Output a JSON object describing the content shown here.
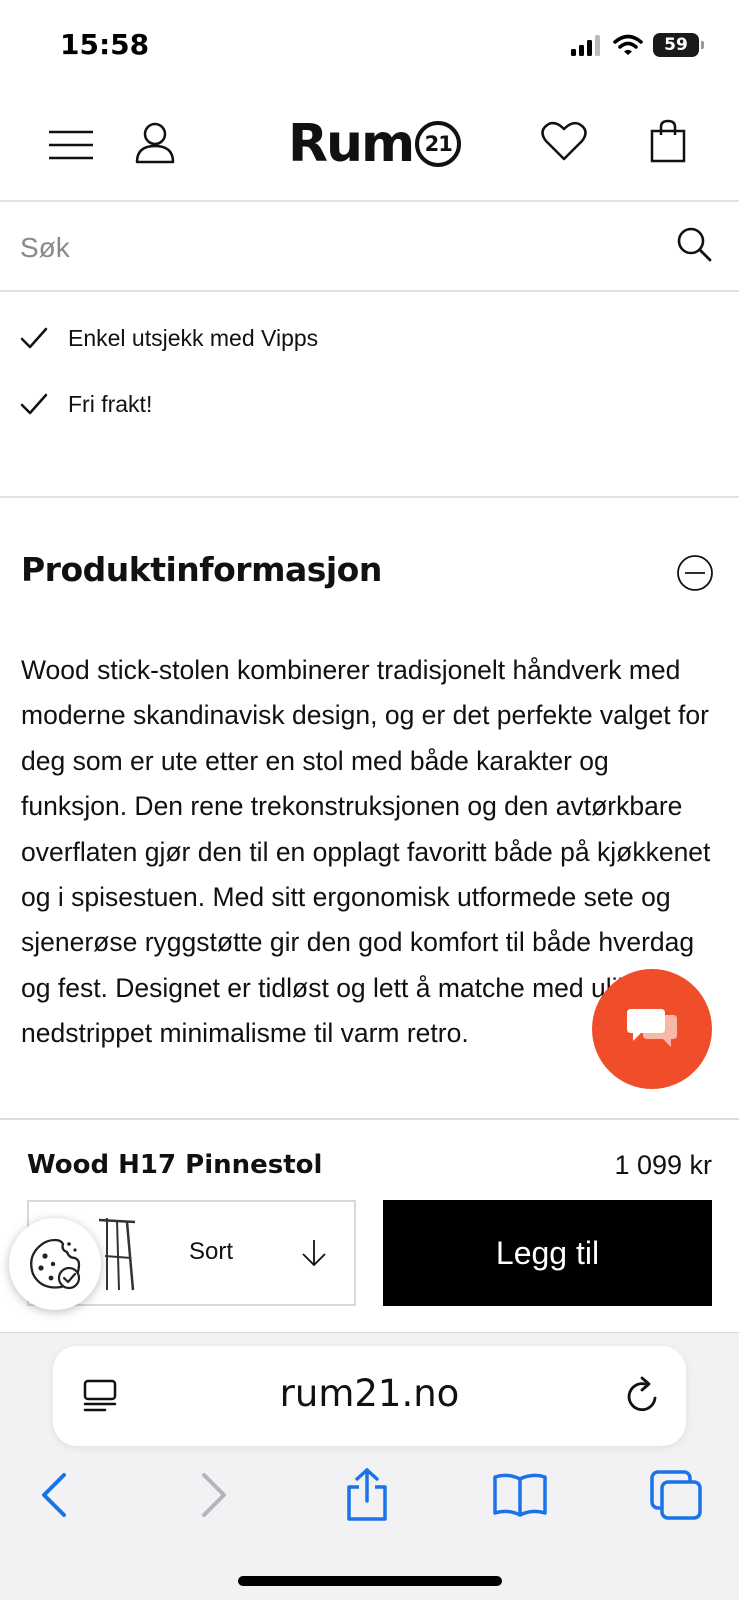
{
  "status_bar": {
    "time": "15:58",
    "battery": "59"
  },
  "header": {
    "logo_text": "Rum",
    "logo_badge": "21"
  },
  "search": {
    "placeholder": "Søk"
  },
  "usps": [
    "Enkel utsjekk med Vipps",
    "Fri frakt!"
  ],
  "product_info": {
    "title": "Produktinformasjon",
    "description": "Wood stick-stolen kombinerer tradisjonelt håndverk med moderne skandinavisk design, og er det perfekte valget for deg som er ute etter en stol med både karakter og funksjon. Den rene trekonstruksjonen og den avtørkbare overflaten gjør den til en opplagt favoritt både på kjøkkenet og i spisestuen. Med sitt ergonomisk utformede sete og sjenerøse ryggstøtte gir den god komfort til både hverdag og fest. Designet er tidløst og lett å matche med ulike fra nedstrippet minimalisme til varm retro."
  },
  "buy_bar": {
    "product_name": "Wood H17 Pinnestol",
    "price": "1 099 kr",
    "variant": "Sort",
    "add_label": "Legg til"
  },
  "browser": {
    "url": "rum21.no"
  },
  "colors": {
    "chat_fab": "#f04d2b",
    "add_button": "#000000",
    "ios_blue": "#1a73e8"
  },
  "icons": [
    "menu-icon",
    "account-icon",
    "heart-icon",
    "bag-icon",
    "search-icon",
    "check-icon",
    "minus-circle-icon",
    "chat-icon",
    "chevron-down-icon",
    "cookie-icon",
    "reader-icon",
    "reload-icon",
    "back-icon",
    "forward-icon",
    "share-icon",
    "bookmarks-icon",
    "tabs-icon"
  ]
}
